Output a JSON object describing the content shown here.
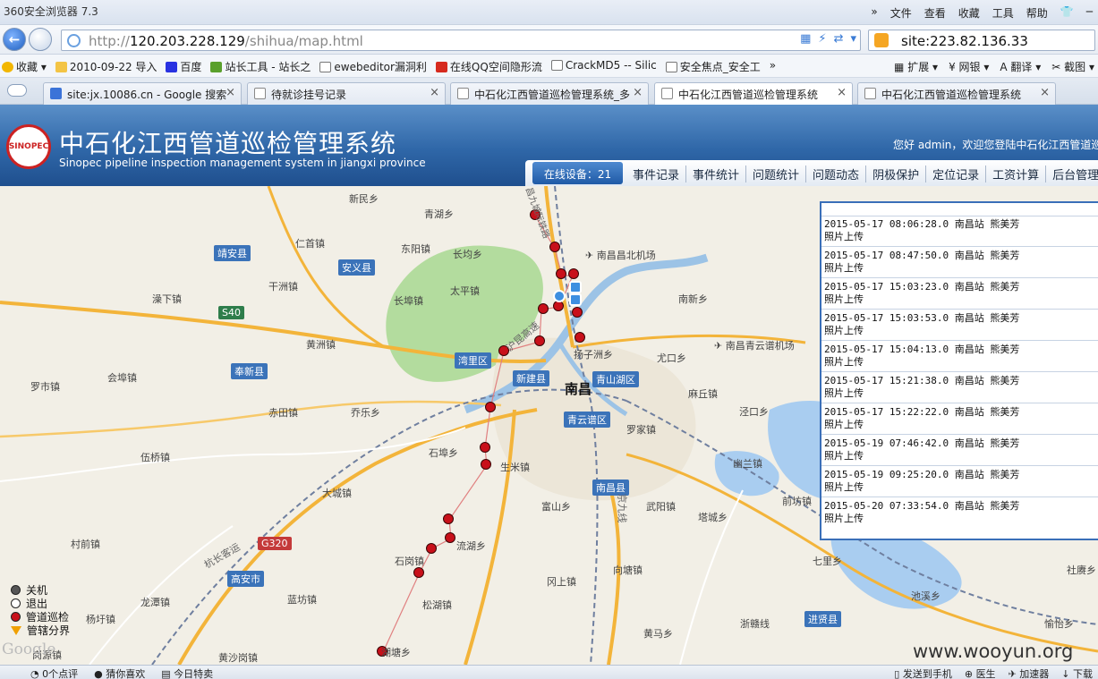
{
  "browser": {
    "title": "360安全浏览器 7.3",
    "menus": [
      "»",
      "文件",
      "查看",
      "收藏",
      "工具",
      "帮助"
    ],
    "url_prefix": "http://",
    "url_host": "120.203.228.129",
    "url_path": "/shihua/map.html",
    "search_query": "site:223.82.136.33",
    "favorites": [
      "收藏",
      "2010-09-22 导入",
      "百度",
      "站长工具 - 站长之",
      "ewebeditor漏洞利",
      "在线QQ空间隐形流",
      "CrackMD5 -- Silic",
      "安全焦点_安全工"
    ],
    "fav_more": "»",
    "toolbar_extras": [
      "扩展",
      "网银",
      "翻译",
      "截图"
    ],
    "tabs": [
      {
        "label": "site:jx.10086.cn - Google 搜索"
      },
      {
        "label": "待就诊挂号记录"
      },
      {
        "label": "中石化江西管道巡检管理系统_多"
      },
      {
        "label": "中石化江西管道巡检管理系统"
      },
      {
        "label": "中石化江西管道巡检管理系统"
      }
    ],
    "tab_close": "×",
    "status_left": [
      "0个点评",
      "猜你喜欢",
      "今日特卖"
    ],
    "status_right": [
      "发送到手机",
      "医生",
      "加速器",
      "下载"
    ]
  },
  "site": {
    "logo_text": "SINOPEC",
    "title": "中石化江西管道巡检管理系统",
    "subtitle": "Sinopec pipeline inspection management system in jiangxi province",
    "welcome": "您好 admin，欢迎您登陆中石化江西管道巡",
    "online_devices": "在线设备：21",
    "menu": [
      "事件记录",
      "事件统计",
      "问题统计",
      "问题动态",
      "阴极保护",
      "定位记录",
      "工资计算",
      "后台管理"
    ]
  },
  "events": [
    {
      "time": "2015-05-17 08:06:28.0",
      "station": "南昌站",
      "person": "熊美芳",
      "action": "照片上传"
    },
    {
      "time": "2015-05-17 08:47:50.0",
      "station": "南昌站",
      "person": "熊美芳",
      "action": "照片上传"
    },
    {
      "time": "2015-05-17 15:03:23.0",
      "station": "南昌站",
      "person": "熊美芳",
      "action": "照片上传"
    },
    {
      "time": "2015-05-17 15:03:53.0",
      "station": "南昌站",
      "person": "熊美芳",
      "action": "照片上传"
    },
    {
      "time": "2015-05-17 15:04:13.0",
      "station": "南昌站",
      "person": "熊美芳",
      "action": "照片上传"
    },
    {
      "time": "2015-05-17 15:21:38.0",
      "station": "南昌站",
      "person": "熊美芳",
      "action": "照片上传"
    },
    {
      "time": "2015-05-17 15:22:22.0",
      "station": "南昌站",
      "person": "熊美芳",
      "action": "照片上传"
    },
    {
      "time": "2015-05-19 07:46:42.0",
      "station": "南昌站",
      "person": "熊美芳",
      "action": "照片上传"
    },
    {
      "time": "2015-05-19 09:25:20.0",
      "station": "南昌站",
      "person": "熊美芳",
      "action": "照片上传"
    },
    {
      "time": "2015-05-20 07:33:54.0",
      "station": "南昌站",
      "person": "熊美芳",
      "action": "照片上传"
    }
  ],
  "legend": [
    {
      "label": "关机",
      "color": "#555555",
      "shape": "dot"
    },
    {
      "label": "退出",
      "color": "#ffffff",
      "shape": "dot"
    },
    {
      "label": "管道巡检",
      "color": "#c8101a",
      "shape": "dot"
    },
    {
      "label": "管辖分界",
      "color": "#f0a000",
      "shape": "triangle"
    }
  ],
  "map": {
    "city": "南昌",
    "places": [
      "新民乡",
      "青湖乡",
      "仁首镇",
      "东阳镇",
      "长均乡",
      "靖安县",
      "安义县",
      "干洲镇",
      "太平镇",
      "南昌昌北机场",
      "澡下镇",
      "长埠镇",
      "南新乡",
      "S40",
      "黄洲镇",
      "湾里区",
      "扬子洲乡",
      "南昌青云谱机场",
      "奉新县",
      "会埠镇",
      "新建县",
      "青山湖区",
      "尤口乡",
      "罗市镇",
      "赤田镇",
      "乔乐乡",
      "麻丘镇",
      "青云谱区",
      "罗家镇",
      "泾口乡",
      "伍桥镇",
      "石埠乡",
      "生米镇",
      "幽兰镇",
      "大城镇",
      "南昌县",
      "富山乡",
      "武阳镇",
      "塔城乡",
      "前坊镇",
      "村前镇",
      "G320",
      "流湖乡",
      "石岗镇",
      "向塘镇",
      "七里乡",
      "社赓乡",
      "高安市",
      "冈上镇",
      "蓝坊镇",
      "龙潭镇",
      "松湖镇",
      "池溪乡",
      "杨圩镇",
      "浙赣线",
      "进贤县",
      "愉怡乡",
      "黄马乡",
      "黄沙岗镇",
      "湖塘乡",
      "岗源镇",
      "南昌",
      "沪昆高速",
      "杭长客运",
      "京九线",
      "昌九城际铁路"
    ],
    "google": "Google",
    "watermark": "www.wooyun.org"
  }
}
